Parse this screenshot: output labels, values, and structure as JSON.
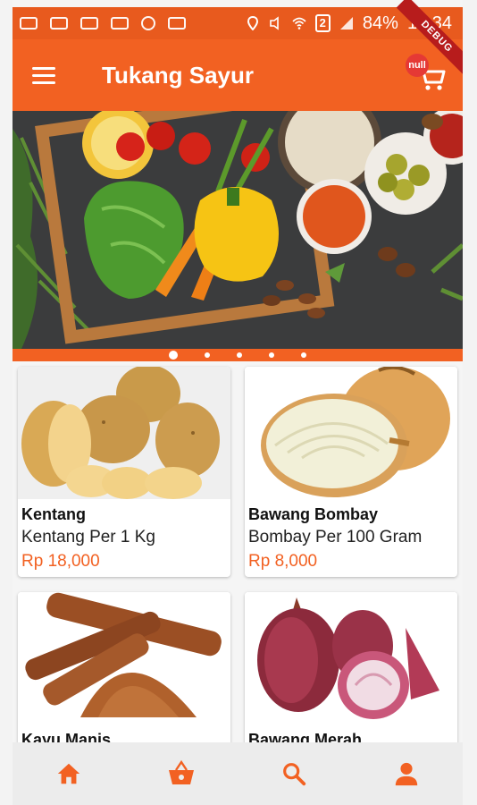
{
  "status_bar": {
    "battery": "84%",
    "time": "18:34",
    "signal_badge": "2"
  },
  "debug_banner": "DEBUG",
  "app_bar": {
    "title": "Tukang Sayur",
    "cart_badge": "null"
  },
  "banner": {
    "page_count": 5,
    "active_page": 1
  },
  "products": [
    {
      "name": "Kentang",
      "desc": "Kentang Per 1 Kg",
      "price": "Rp 18,000"
    },
    {
      "name": "Bawang Bombay",
      "desc": "Bombay Per 100 Gram",
      "price": "Rp 8,000"
    },
    {
      "name": "Kayu Manis",
      "desc": "",
      "price": ""
    },
    {
      "name": "Bawang Merah",
      "desc": "",
      "price": ""
    }
  ],
  "bottom_nav": [
    "home-icon",
    "basket-icon",
    "search-icon",
    "person-icon"
  ],
  "colors": {
    "primary": "#f26122",
    "status": "#e85a1e",
    "price": "#f26122"
  }
}
